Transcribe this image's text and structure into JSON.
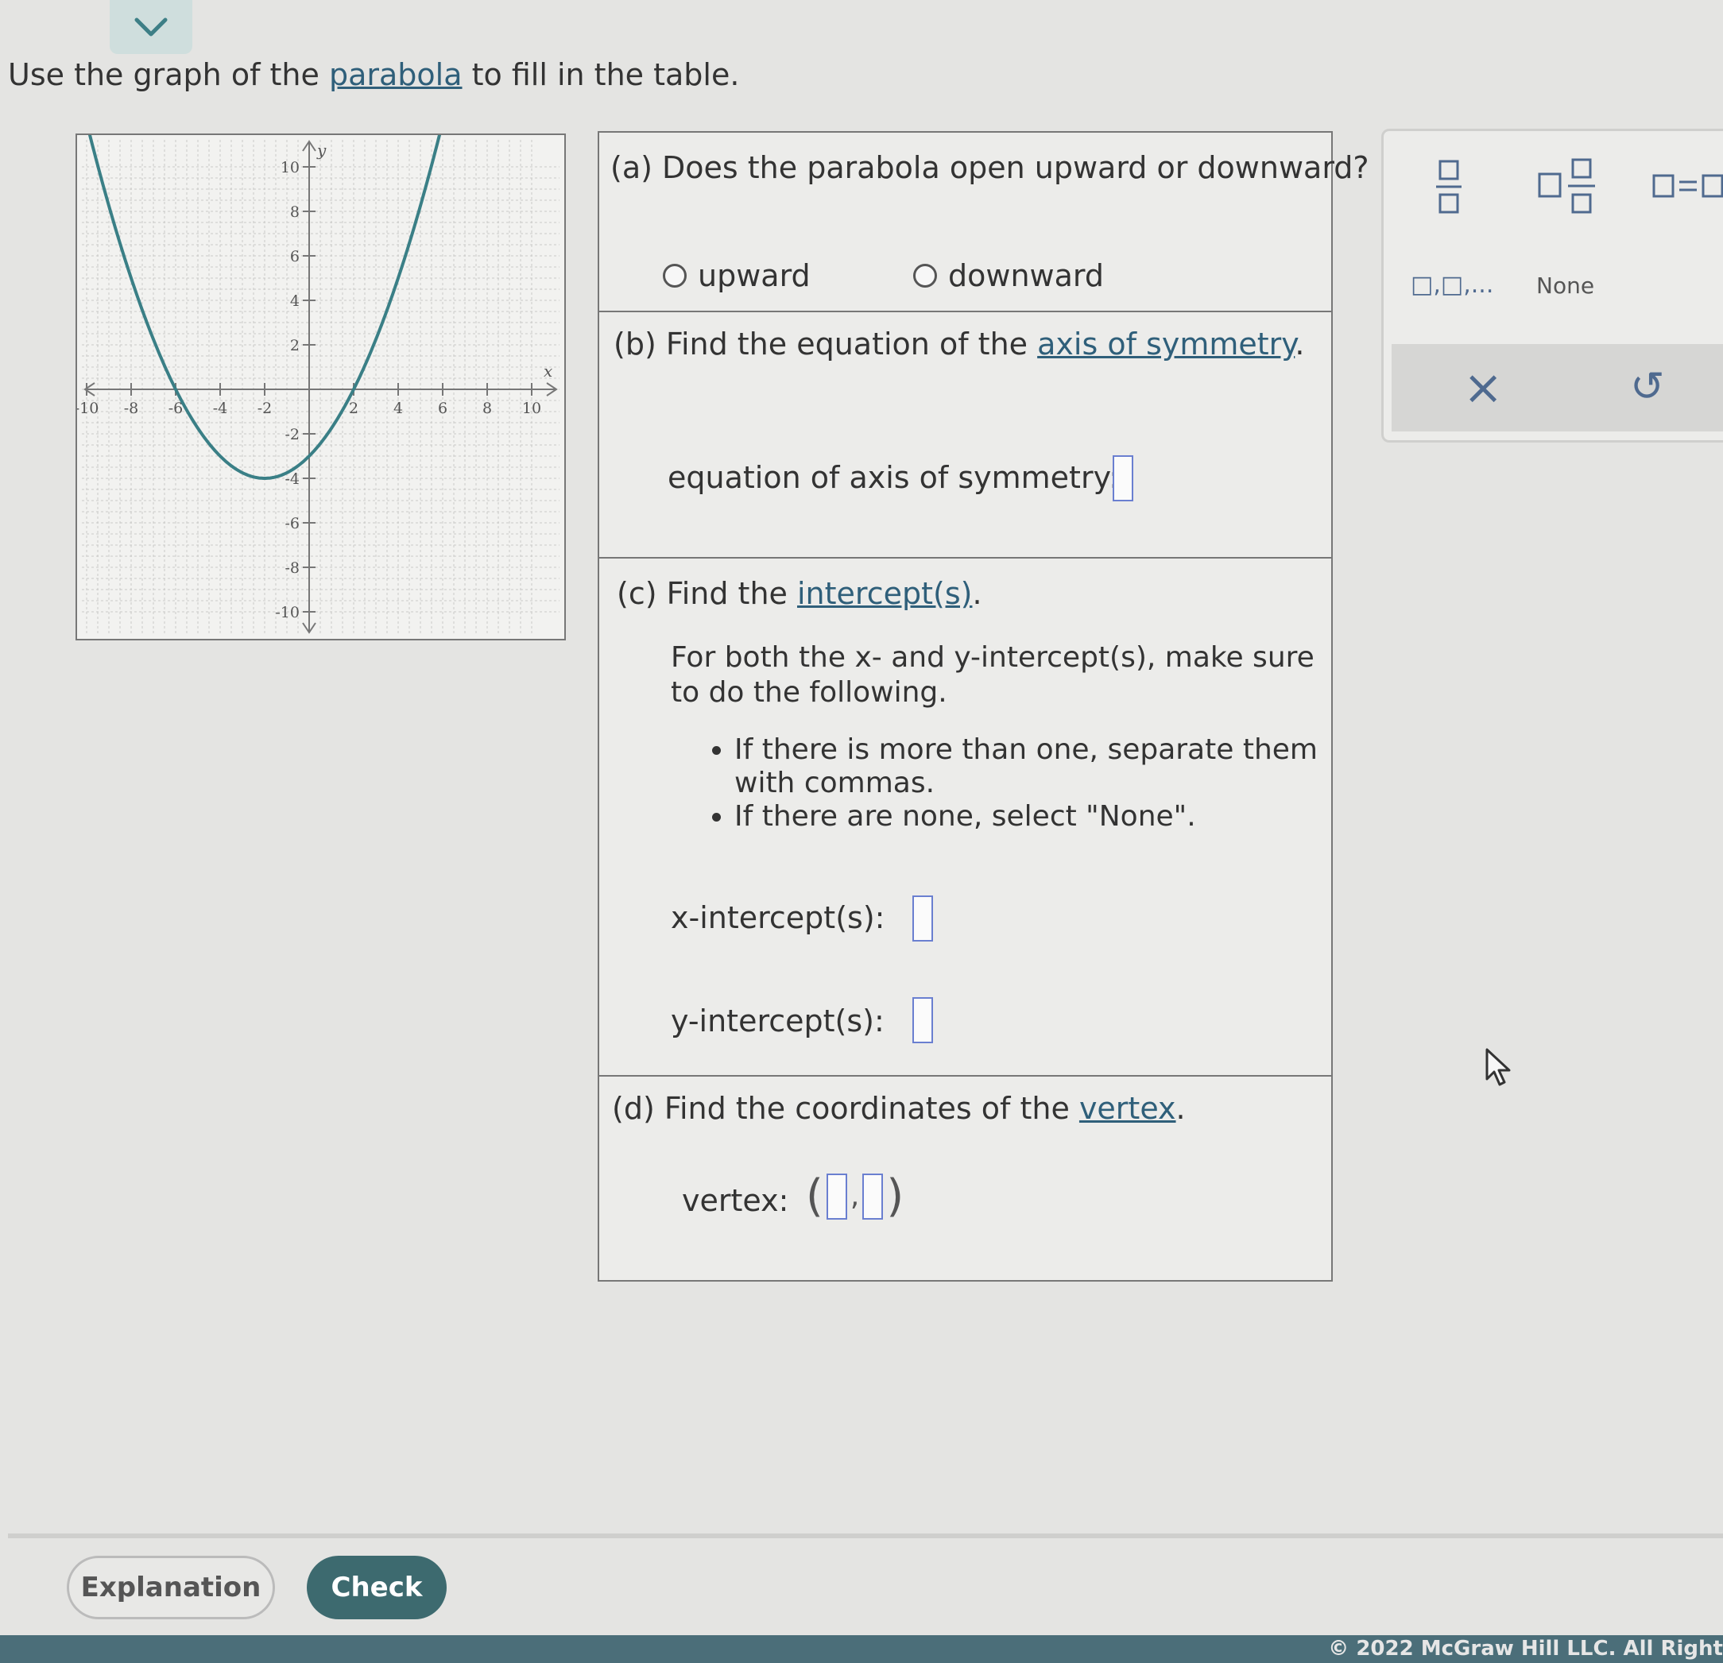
{
  "prompt": {
    "before": "Use the graph of the ",
    "link": "parabola",
    "after": " to fill in the table."
  },
  "graph": {
    "x_label": "x",
    "y_label": "y",
    "x_ticks": [
      "-10",
      "-8",
      "-6",
      "-4",
      "-2",
      "2",
      "4",
      "6",
      "8",
      "10"
    ],
    "y_ticks": [
      "10",
      "8",
      "6",
      "4",
      "2",
      "-2",
      "-4",
      "-6",
      "-8",
      "-10"
    ],
    "range": [
      -10,
      10
    ],
    "curve_color": "#3a7f86",
    "curve": {
      "vertex_x": -2,
      "vertex_y": -4,
      "a": 0.25
    }
  },
  "part_a": {
    "question": "(a) Does the parabola open upward or downward?",
    "option_up": "upward",
    "option_down": "downward"
  },
  "part_b": {
    "question_before": "(b) Find the equation of the ",
    "question_link": "axis of symmetry",
    "question_after": ".",
    "label": "equation of axis of symmetry:"
  },
  "part_c": {
    "question_before": "(c) Find the ",
    "question_link": "intercept(s)",
    "question_after": ".",
    "instructions_line1": "For both the x- and y-intercept(s), make sure",
    "instructions_line2": "to do the following.",
    "bullet1_line1": "If there is more than one, separate them",
    "bullet1_line2": "with commas.",
    "bullet2": "If there are none, select \"None\".",
    "x_label": "x-intercept(s):",
    "y_label": "y-intercept(s):"
  },
  "part_d": {
    "question_before": "(d) Find the coordinates of the ",
    "question_link": "vertex",
    "question_after": ".",
    "label": "vertex:"
  },
  "palette": {
    "list_label": "□,□,...",
    "none_label": "None",
    "clear_symbol": "×",
    "undo_symbol": "↺"
  },
  "buttons": {
    "explanation": "Explanation",
    "check": "Check"
  },
  "footer": {
    "copyright": "© 2022 McGraw Hill LLC. All Right"
  }
}
